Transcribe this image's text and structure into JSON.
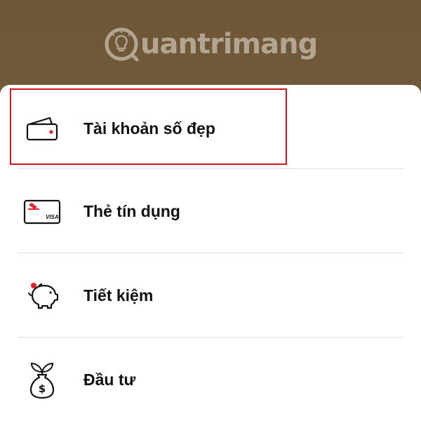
{
  "watermark": {
    "text": "uantrimang"
  },
  "menu": {
    "items": [
      {
        "label": "Tài khoản số đẹp",
        "icon": "wallet-icon"
      },
      {
        "label": "Thẻ tín dụng",
        "icon": "credit-card-icon",
        "card_brand": "VISA"
      },
      {
        "label": "Tiết kiệm",
        "icon": "piggy-bank-icon"
      },
      {
        "label": "Đầu tư",
        "icon": "money-bag-sprout-icon"
      }
    ]
  },
  "colors": {
    "background_top": "#6e5637",
    "sheet": "#ffffff",
    "accent_red": "#e3232a",
    "highlight_border": "#d9141c",
    "text": "#111111",
    "divider": "#dedede"
  }
}
